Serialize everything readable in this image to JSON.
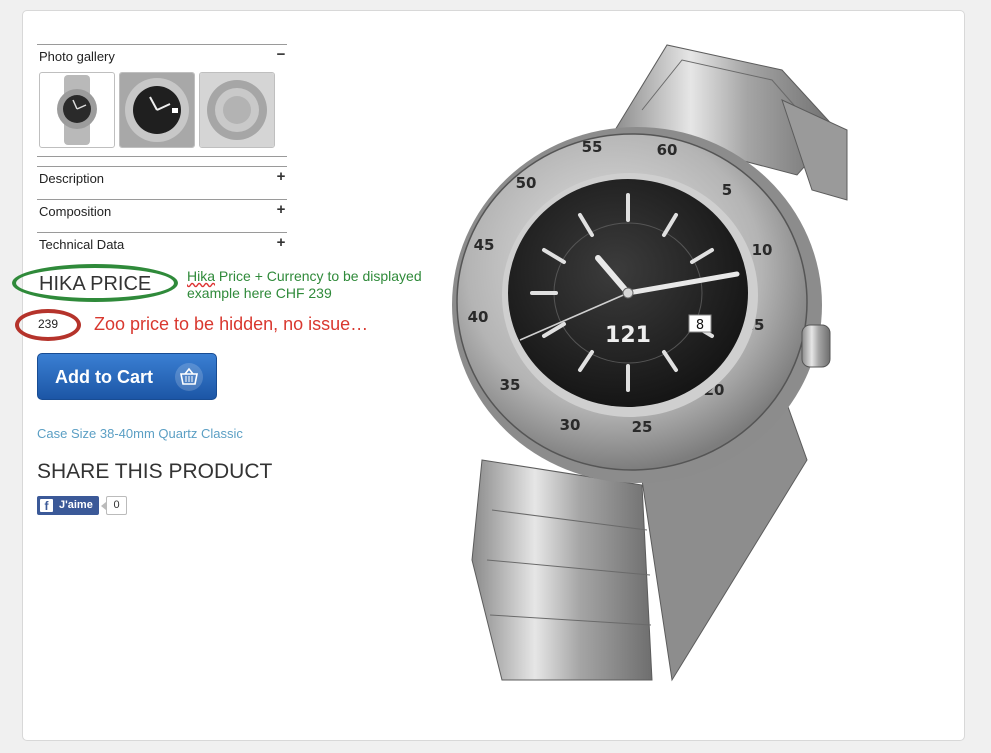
{
  "accordion": {
    "gallery_label": "Photo gallery",
    "gallery_toggle": "−",
    "description_label": "Description",
    "composition_label": "Composition",
    "technical_label": "Technical Data",
    "expand_sign": "+"
  },
  "price": {
    "hika_label": "HIKA PRICE",
    "zoo_value": "239"
  },
  "annotations": {
    "green_note_word": "Hika",
    "green_note_rest": " Price + Currency to be displayed",
    "green_note_line2": "example here CHF 239",
    "red_note": "Zoo price to be hidden, no issue…",
    "green_color": "#2f8a3a",
    "red_color": "#d9382f"
  },
  "cart": {
    "label": "Add to Cart",
    "icon": "basket-icon"
  },
  "product": {
    "case_size": "Case Size 38-40mm Quartz Classic"
  },
  "share": {
    "title": "SHARE THIS PRODUCT",
    "like_label": "J'aime",
    "like_count": "0",
    "brand_color": "#3b5998"
  },
  "watch": {
    "brand": "121",
    "date": "8",
    "bezel_numbers": [
      "55",
      "60",
      "5",
      "10",
      "15",
      "20",
      "25",
      "30",
      "35",
      "40",
      "45",
      "50"
    ]
  }
}
